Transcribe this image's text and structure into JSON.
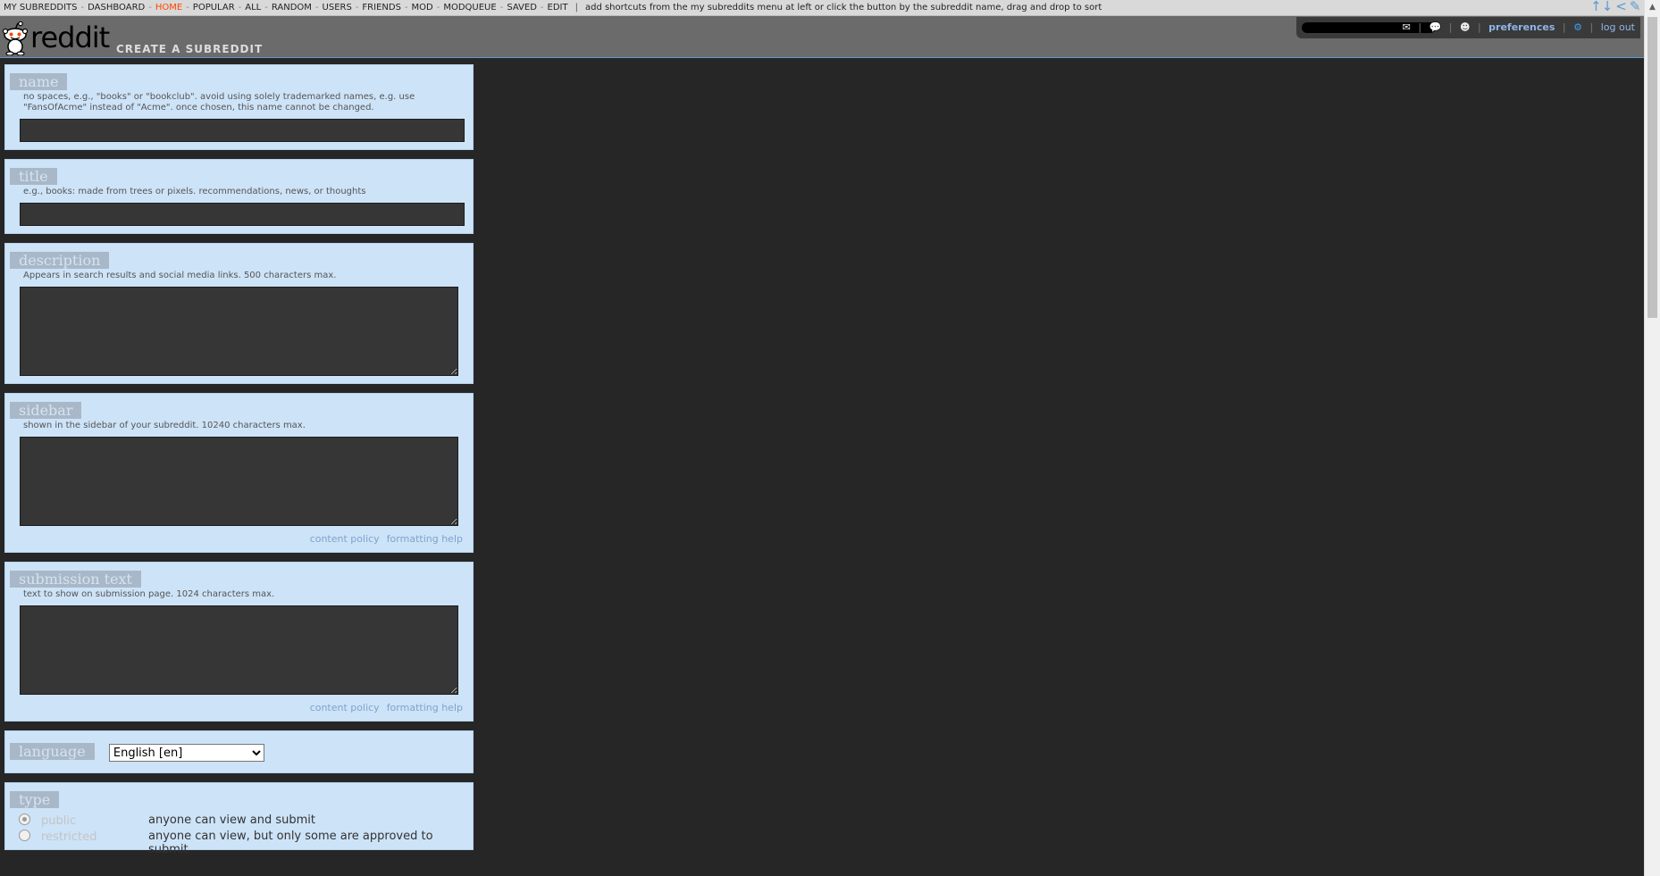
{
  "topbar": {
    "items": [
      "MY SUBREDDITS",
      "DASHBOARD",
      "HOME",
      "POPULAR",
      "ALL",
      "RANDOM",
      "USERS",
      "FRIENDS",
      "MOD",
      "MODQUEUE",
      "SAVED",
      "EDIT"
    ],
    "active": "HOME",
    "hint": "add shortcuts from the my subreddits menu at left or click the button by the subreddit name, drag and drop to sort",
    "controls": [
      "↑↓",
      "<",
      "✎",
      ">"
    ]
  },
  "header": {
    "logo_text": "reddit",
    "page_title": "CREATE A SUBREDDIT",
    "user": {
      "preferences": "preferences",
      "logout": "log out"
    }
  },
  "form": {
    "name": {
      "label": "name",
      "hint": "no spaces, e.g., \"books\" or \"bookclub\". avoid using solely trademarked names, e.g. use \"FansOfAcme\" instead of \"Acme\". once chosen, this name cannot be changed.",
      "value": ""
    },
    "title": {
      "label": "title",
      "hint": "e.g., books: made from trees or pixels. recommendations, news, or thoughts",
      "value": ""
    },
    "description": {
      "label": "description",
      "hint": "Appears in search results and social media links. 500 characters max.",
      "value": ""
    },
    "sidebar": {
      "label": "sidebar",
      "hint": "shown in the sidebar of your subreddit. 10240 characters max.",
      "value": "",
      "link1": "content policy",
      "link2": "formatting help"
    },
    "submission_text": {
      "label": "submission text",
      "hint": "text to show on submission page. 1024 characters max.",
      "value": "",
      "link1": "content policy",
      "link2": "formatting help"
    },
    "language": {
      "label": "language",
      "selected": "English [en]"
    },
    "type": {
      "label": "type",
      "options": [
        {
          "name": "public",
          "desc": "anyone can view and submit",
          "selected": true
        },
        {
          "name": "restricted",
          "desc": "anyone can view, but only some are approved to submit",
          "selected": false
        }
      ]
    }
  }
}
